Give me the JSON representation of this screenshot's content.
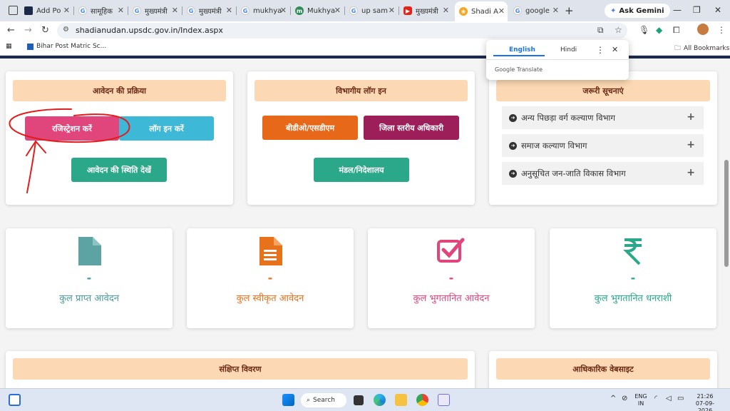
{
  "browser": {
    "tabs": [
      {
        "label": "Add Po",
        "favicon": "site-favicon"
      },
      {
        "label": "सामूहिक",
        "favicon": "google-icon"
      },
      {
        "label": "मुख्यमंत्री",
        "favicon": "google-icon"
      },
      {
        "label": "मुख्यमंत्री",
        "favicon": "google-icon"
      },
      {
        "label": "mukhya",
        "favicon": "google-icon"
      },
      {
        "label": "Mukhya",
        "favicon": "site-favicon"
      },
      {
        "label": "up sam",
        "favicon": "google-icon"
      },
      {
        "label": "मुख्यमंत्री",
        "favicon": "youtube-icon"
      },
      {
        "label": "Shadi A",
        "favicon": "site-favicon",
        "active": true
      },
      {
        "label": "google",
        "favicon": "google-icon"
      }
    ],
    "gemini_label": "Ask Gemini",
    "url": "shadianudan.upsdc.gov.in/Index.aspx",
    "bookmark": "Bihar Post Matric Sc...",
    "all_bookmarks": "All Bookmarks"
  },
  "translate_popup": {
    "tab_english": "English",
    "tab_hindi": "Hindi",
    "footer": "Google Translate"
  },
  "process_card": {
    "title": "आवेदन की प्रक्रिया",
    "register_btn": "रजिस्ट्रेशन करें",
    "login_btn": "लॉग इन करें",
    "status_btn": "आवेदन की स्थिति देखें"
  },
  "dept_card": {
    "title": "विभागीय लॉग इन",
    "bdo_btn": "बीडीओ/एसडीएम",
    "district_btn": "जिला स्तरीय अधिकारी",
    "division_btn": "मंडल/निदेशालय"
  },
  "notices_card": {
    "title": "जरूरी सूचनाएं",
    "items": [
      {
        "label": "अन्य पिछड़ा वर्ग कल्याण विभाग"
      },
      {
        "label": "समाज कल्याण विभाग"
      },
      {
        "label": "अनुसूचित जन-जाति विकास विभाग"
      }
    ]
  },
  "stats": [
    {
      "value": "-",
      "label": "कुल प्राप्त आवेदन",
      "color": "#4e9a9a",
      "icon": "document-icon"
    },
    {
      "value": "-",
      "label": "कुल स्वीकृत आवेदन",
      "color": "#e8711c",
      "icon": "file-text-icon"
    },
    {
      "value": "-",
      "label": "कुल भुगतानित आवेदन",
      "color": "#e0457b",
      "icon": "check-square-icon"
    },
    {
      "value": "-",
      "label": "कुल भुगतानित धनराशी",
      "color": "#2aa889",
      "icon": "rupee-icon"
    }
  ],
  "summary_card": {
    "title": "संक्षिप्त विवरण"
  },
  "official_card": {
    "title": "आधिकारिक वेबसाइट"
  },
  "taskbar": {
    "search_label": "Search",
    "lang": "ENG",
    "region": "IN",
    "time": "21:26",
    "date": "07-09-2026"
  },
  "colors": {
    "register": "#e0457b",
    "login": "#3db8d6",
    "status": "#2aa889",
    "bdo": "#e8681a",
    "district": "#9c1f5a",
    "division": "#2aa889",
    "card_head_bg": "#fcd9b4",
    "annotation": "#e21b1b"
  }
}
